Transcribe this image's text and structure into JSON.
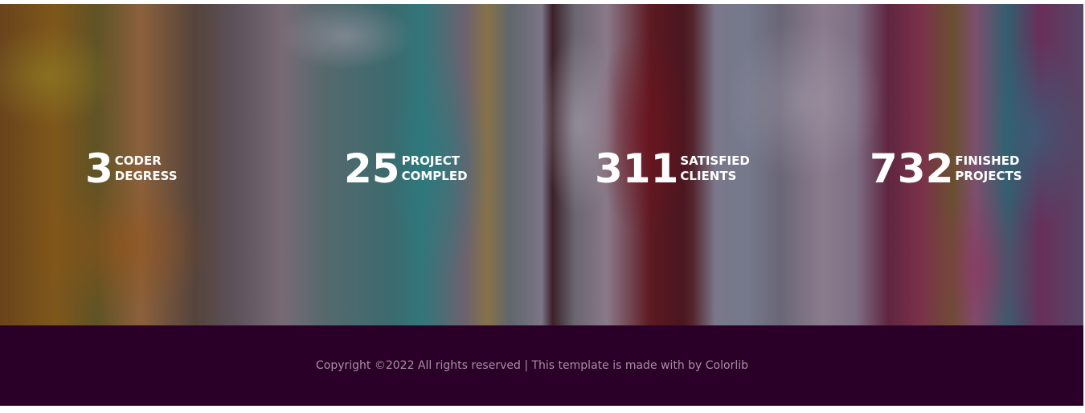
{
  "hero": {
    "stats": [
      {
        "number": "3",
        "label_line1": "CODER",
        "label_line2": "DEGRESS"
      },
      {
        "number": "25",
        "label_line1": "PROJECT",
        "label_line2": "COMPLED"
      },
      {
        "number": "311",
        "label_line1": "SATISFIED",
        "label_line2": "CLIENTS"
      },
      {
        "number": "732",
        "label_line1": "FINISHED",
        "label_line2": "PROJECTS"
      }
    ]
  },
  "footer": {
    "copyright": "Copyright ©2022 All rights reserved | This template is made with by Colorlib",
    "background_color": "#2b0028"
  }
}
